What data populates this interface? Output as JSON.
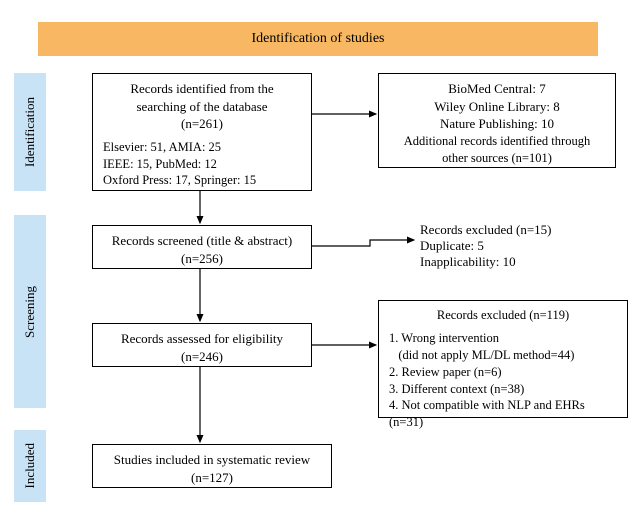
{
  "header": {
    "title": "Identification of studies"
  },
  "stages": {
    "identification": "Identification",
    "screening": "Screening",
    "included": "Included"
  },
  "boxes": {
    "identified": {
      "line1": "Records identified from the",
      "line2": "searching of the database",
      "line3": "(n=261)",
      "d1": "Elsevier: 51, AMIA: 25",
      "d2": "IEEE: 15, PubMed: 12",
      "d3": "Oxford Press: 17, Springer: 15"
    },
    "additional": {
      "l1": "BioMed Central: 7",
      "l2": "Wiley Online Library: 8",
      "l3": "Nature Publishing: 10",
      "l4": "Additional records identified through",
      "l5": "other sources (n=101)"
    },
    "screened": {
      "l1": "Records screened (title & abstract)",
      "l2": "(n=256)"
    },
    "excluded1": {
      "l1": "Records excluded (n=15)",
      "l2": "Duplicate: 5",
      "l3": "Inapplicability: 10"
    },
    "assessed": {
      "l1": "Records assessed for eligibility",
      "l2": "(n=246)"
    },
    "excluded2": {
      "title": "Records excluded (n=119)",
      "r1": "1. Wrong intervention",
      "r1b": "   (did not apply ML/DL method=44)",
      "r2": "2. Review paper (n=6)",
      "r3": "3. Different context (n=38)",
      "r4": "4. Not compatible with NLP and EHRs (n=31)"
    },
    "included": {
      "l1": "Studies included in systematic review",
      "l2": "(n=127)"
    }
  }
}
